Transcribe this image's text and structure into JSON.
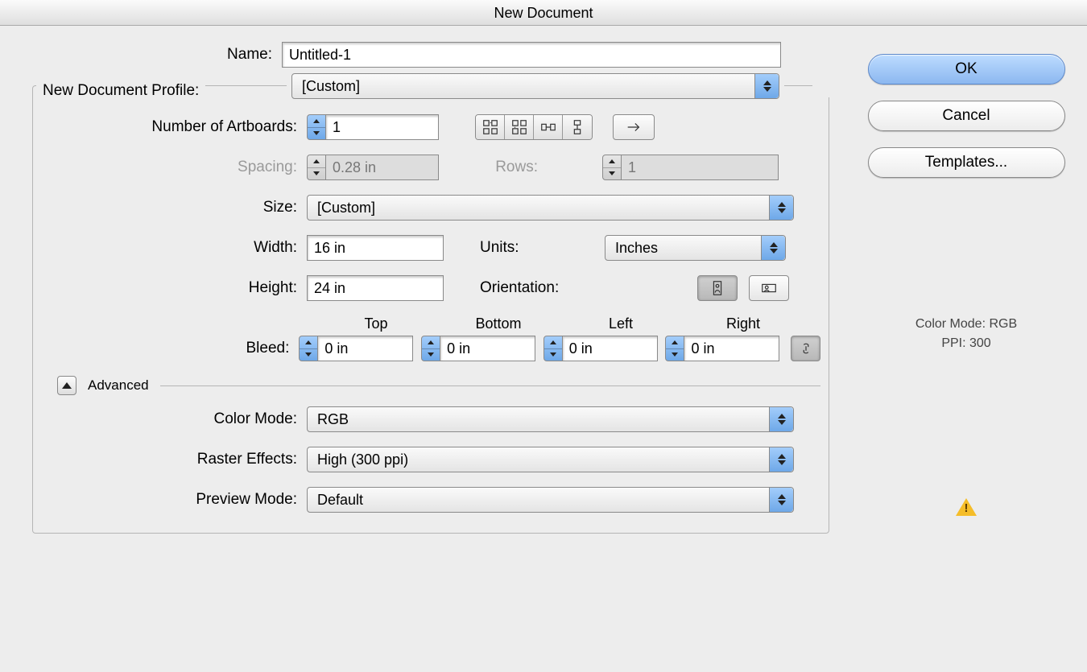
{
  "title": "New Document",
  "labels": {
    "name": "Name:",
    "profile": "New Document Profile:",
    "artboards": "Number of Artboards:",
    "spacing": "Spacing:",
    "rows": "Rows:",
    "size": "Size:",
    "width": "Width:",
    "height": "Height:",
    "units": "Units:",
    "orientation": "Orientation:",
    "bleed": "Bleed:",
    "top": "Top",
    "bottom": "Bottom",
    "left": "Left",
    "right": "Right",
    "advanced": "Advanced",
    "colormode": "Color Mode:",
    "raster": "Raster Effects:",
    "preview": "Preview Mode:"
  },
  "values": {
    "name": "Untitled-1",
    "profile": "[Custom]",
    "artboards": "1",
    "spacing": "0.28 in",
    "rows": "1",
    "size": "[Custom]",
    "width": "16 in",
    "height": "24 in",
    "units": "Inches",
    "bleed_top": "0 in",
    "bleed_bottom": "0 in",
    "bleed_left": "0 in",
    "bleed_right": "0 in",
    "colormode": "RGB",
    "raster": "High (300 ppi)",
    "preview": "Default"
  },
  "buttons": {
    "ok": "OK",
    "cancel": "Cancel",
    "templates": "Templates..."
  },
  "meta": {
    "colormode": "Color Mode: RGB",
    "ppi": "PPI: 300"
  }
}
